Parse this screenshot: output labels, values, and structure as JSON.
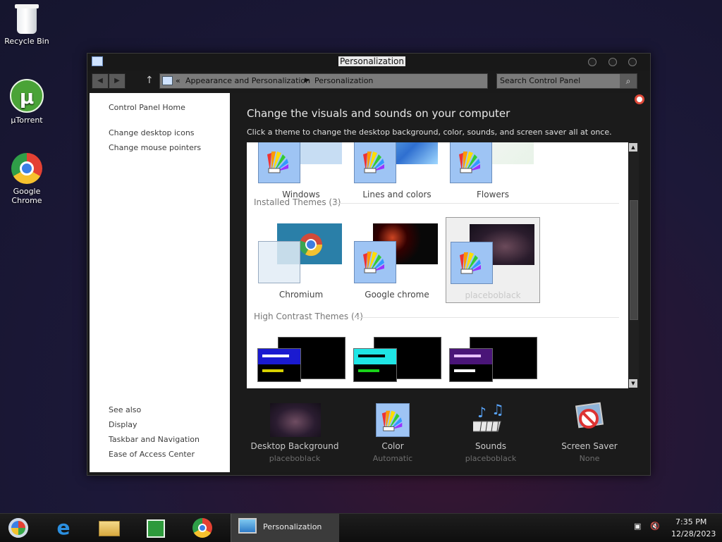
{
  "desktop": {
    "icons": [
      {
        "label": "Recycle Bin"
      },
      {
        "label": "µTorrent"
      },
      {
        "label": "Google Chrome"
      }
    ]
  },
  "window": {
    "title": "Personalization",
    "breadcrumbs": [
      "Appearance and Personalization",
      "Personalization"
    ],
    "crumb_separator": "«",
    "search_placeholder": "Search Control Panel"
  },
  "sidebar": {
    "items": [
      "Control Panel Home",
      "Change desktop icons",
      "Change mouse pointers"
    ],
    "see_also_heading": "See also",
    "see_also": [
      "Display",
      "Taskbar and Navigation",
      "Ease of Access Center"
    ]
  },
  "main": {
    "title": "Change the visuals and sounds on your computer",
    "subtitle": "Click a theme to change the desktop background, color, sounds, and screen saver all at once.",
    "default_themes": [
      "Windows",
      "Lines and colors",
      "Flowers"
    ],
    "installed_heading": "Installed Themes (3)",
    "installed_themes": [
      "Chromium",
      "Google chrome",
      "placeboblack"
    ],
    "high_contrast_heading": "High Contrast Themes (4)"
  },
  "bottom_bar": [
    {
      "label": "Desktop Background",
      "value": "placeboblack"
    },
    {
      "label": "Color",
      "value": "Automatic"
    },
    {
      "label": "Sounds",
      "value": "placeboblack"
    },
    {
      "label": "Screen Saver",
      "value": "None"
    }
  ],
  "taskbar": {
    "active_task": "Personalization",
    "time": "7:35 PM",
    "date": "12/28/2023"
  },
  "colors": {
    "accent_blue": "#9ec4f4",
    "window_bg": "#1b1b1b"
  }
}
